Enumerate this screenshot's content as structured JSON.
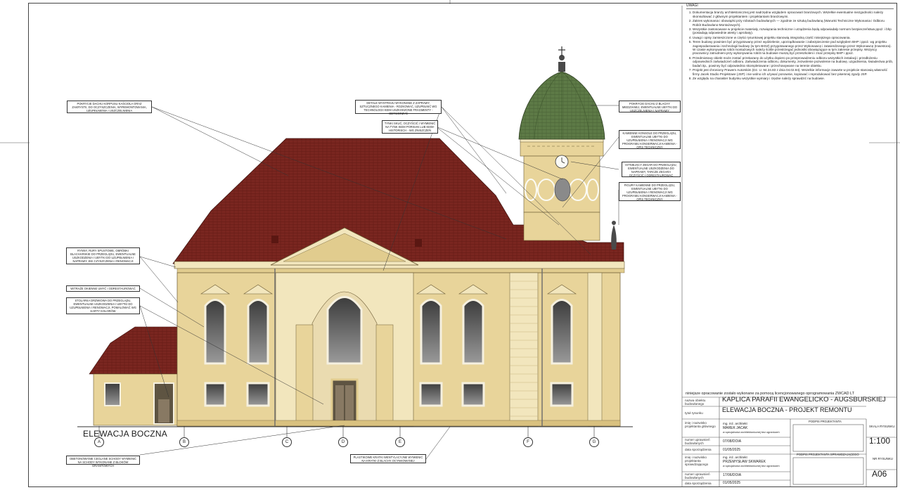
{
  "notes": {
    "title": "UWAGI",
    "items": [
      "Dokumentacja branży architektonicznej jest nadrzędna względem opracowań branżowych. Wszelkie ewentualne niezgodności należy skonsultować z głównym projektantem i projektantami branżowymi.",
      "Zakres wykonania i obowiązki przy robotach budowlanych — zgodnie ze sztuką budowlaną (Warunki Techniczne Wykonania i Odbioru Robót Budowlano-Montażowych).",
      "Wszystkie zastosowane w projekcie materiały, rozwiązania techniczne i urządzenia będą odpowiadały normom bezpieczeństwa ppoż. i bhp (posiadają odpowiednie atesty i aprobaty).",
      "Uwagi i opisy zamieszczone w części rysunkowej projektu stanowią integralną część niniejszego opracowania.",
      "Teren budowy powinien być przygotowany przez wydzielenie, uporządkowanie i zabezpieczenie pod względem BHP i ppoż. wg projektu zagospodarowania i technologii budowy (w tym BIOZ) przygotowanego przez Wykonawcę i zatwierdzonego przez Wykonawcę (Inwestora). W czasie wykonywania robót montażowych należy ściśle przestrzegać jednostki obowiązujące w tym zakresie przepisy. Wszyscy pracownicy zatrudnieni przy wykonywaniu robót na budowie muszą być przeszkoleni i znać przepisy BHP i ppoż.",
      "Przedmiotowy obiekt może zostać przekazany do użytku dopiero po przeprowadzeniu odbioru wszystkich instalacji i przedłożeniu odpowiednich zaświadczeń odbioru. Zaświadczenia odbioru, dokumenty, zezwolenie pozwolenie na budowę, uzgodnienia, świadectwa prób, badań itp., powinny być odpowiednio skompletowane i przechowywane na terenie obiektu.",
      "Projekt jest chroniony Prawem Autorskim (Dz. U. 94.24.83 z dnia 04.02.94). Wszelkie informacje zawarte w projekcie stanowią własność firmy Jacek Studio Projektowe (JSP) i nie wolno ich używać ponownie, kopiować i reprodukować bez pisemnej zgody JSP.",
      "Ze względu na charakter budynku wszystkie wymiary i rzędne należy sprawdzić na budowie."
    ]
  },
  "callouts": {
    "roof": "POKRYCIE DACHU KORPUSU KAŚCIOŁA ORAZ ZAKRYSTII, DO OCZYSZCZENIA, WYREMONTOWANIA, UZUPEŁNIENIA I USZCZELNIENIA",
    "cornice": "DETALE WYSTROJU WYKONANE Z ZAPRAWY, SZTUCZNEGO KAMIENIA - ROZKOWAĆ, UZUPEŁNIĆ WG TECHNOLOGII KEIM USZKODZONE FRAGMENTY - ODTWORZYĆ",
    "plaster": "TYNKI SKUĆ, OCZYŚCIĆ I WYMIENIĆ NA TYNK KEIM PORISAN LUB KEIM-HISTORISCH - WG ZNISZCZEŃ",
    "dome": "POKRYCIE DACHU Z BLACHY MIEDZIANEJ, EWENTUALNE UBYTKI DO USZCZELNIENIA I NAPRAWY",
    "console": "KAMIENNE KONSOLE DO PRZEGLĄDU, EWENTUALNE UBYTKI DO UZUPEŁNIENIA I RENOWACJI WG PROGRAMU KONSERWACJI KAMIENIA - OPIS TECHNICZNY",
    "clock": "ISTNIEJĄCY ZEGAR DO PRZEGLĄDU, EWENTUALNE USZKODZENIA DO NAPRAWY, TARCZE ZEGARA OCZYŚCIĆ I ODRESTAUROWAĆ",
    "figures": "FIGURY KAMIENNE DO PRZEGLĄDU, EWENTUALNE UBYTKI DO UZUPEŁNIENIA I RENOWACJI WG PROGRAMU KONSERWACJI KAMIENIA - OPIS TECHNICZNY",
    "gutters": "RYNNY, RURY SPUSTOWE, OBRÓBKI BLACHARSKIE DO PRZEGLĄDU, EWENTUALNE USZKODZENIA I UBYTKI DO UZUPEŁNIENIA I NAPRAWY, EKI CZYSZCZENIA I RENOWACJI",
    "stained": "WITRAŻE OKIENNE UMYĆ I ODRESTAUROWAĆ",
    "joinery": "STOLARKA DRZWIOWA DO PRZEGLĄDU, EWENTUALNE USZKODZENIA I UBYTKI DO UZUPEŁNIENIA I RENOWACJI, POMALOWAĆ WG KARTY KOLORÓW",
    "plinth": "OBETONOWANIE CEGLANE SCHODY WYMIENIĆ NA SCHODY WYKONANE Z BLOKÓW GRANITOWYCH",
    "vents": "PLASTIKOWE KRATKI WENTYLACYJNE WYMIENIĆ NA KRATKI Z BLACHY OCYNKOWANEJ"
  },
  "drawing": {
    "elevation_title": "ELEWACJA BOCZNA",
    "axes": [
      "A",
      "B",
      "C",
      "D",
      "E",
      "F",
      "G"
    ]
  },
  "title_block": {
    "software_note": "niniejsze opracowanie zostało wykonane za pomocą licencjonowanego oprogramowania ZWCAD LT",
    "object_label": "nazwa obiektu budowlanego",
    "object_value": "KAPLICA PARAFII EWANGELICKO - AUGSBURSKIEJ",
    "drawing_label": "tytuł rysunku",
    "drawing_value": "ELEWACJA BOCZNA - PROJEKT REMONTU",
    "designer_label": "imię i nazwisko projektanta głównego",
    "designer_title": "mg. inż. architekt",
    "designer_name": "MAREK JACAK",
    "designer_spec": "w specjalności architektonicznej bez ograniczeń",
    "designer_sign": "PODPIS PROJEKTANTA",
    "perm1_label": "numer uprawnień budowlanych",
    "perm1_value": "07/08/DOIA",
    "date1_label": "data sporządzenia",
    "date1_value": "01/05/2025",
    "checker_label": "imię i nazwisko projektanta sprawdzającego",
    "checker_title": "mg. inż. architekt",
    "checker_name": "PRZEMYSŁAW SKWAREK",
    "checker_spec": "w specjalności architektonicznej bez ograniczeń",
    "checker_sign": "PODPIS PROJEKTANTA SPRAWDZAJĄCEGO",
    "perm2_label": "numer uprawnień budowlanych",
    "perm2_value": "17/06/DOIA",
    "date2_label": "data sporządzenia",
    "date2_value": "01/05/2025",
    "scale_label": "SKALA RYSUNKU",
    "scale_value": "1:100",
    "sheet_label": "NR RYSUNKU",
    "sheet_value": "A06"
  },
  "colors": {
    "roof": "#7a2620",
    "wall": "#e8d49a",
    "pilaster": "#f2e6bd",
    "dome": "#5d7a46",
    "window": "#6e6e6e"
  }
}
